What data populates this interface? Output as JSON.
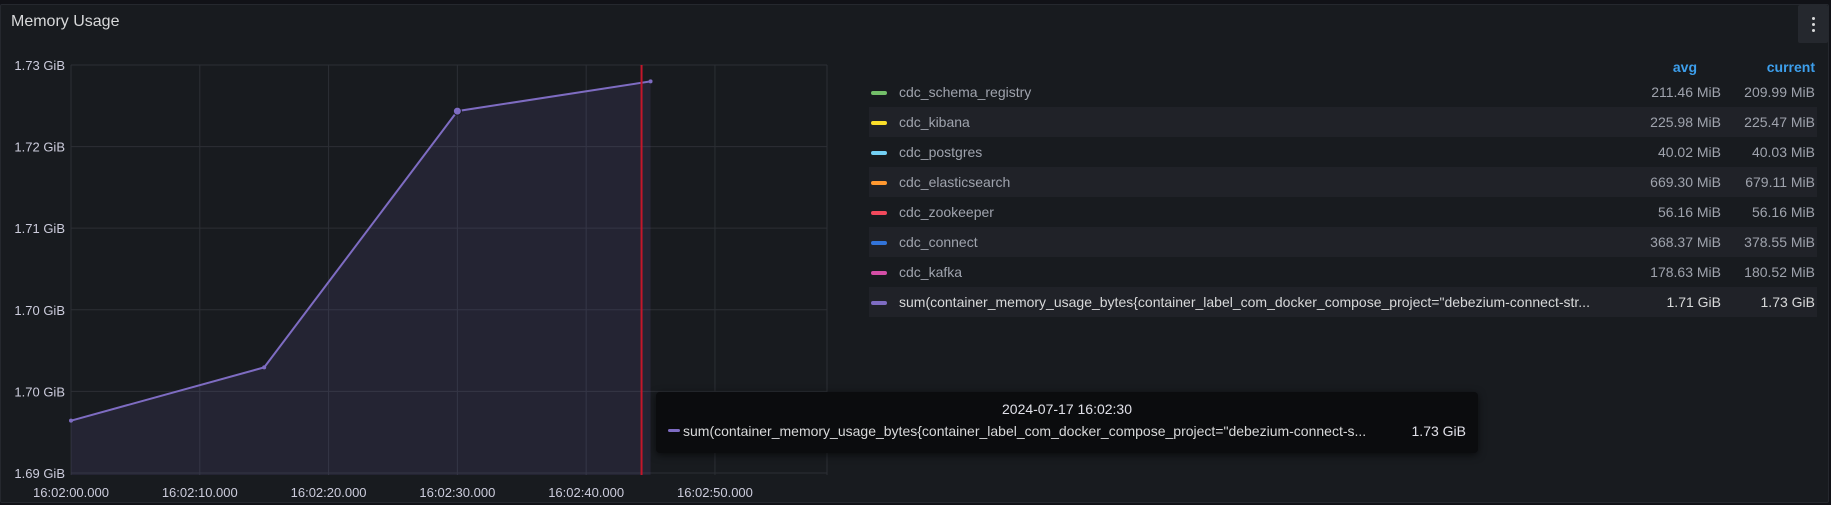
{
  "panel": {
    "title": "Memory Usage"
  },
  "chart_data": {
    "type": "area",
    "title": "Memory Usage",
    "y_ticks": [
      "1.73 GiB",
      "1.72 GiB",
      "1.71 GiB",
      "1.70 GiB",
      "1.70 GiB",
      "1.69 GiB"
    ],
    "x_ticks": [
      "16:02:00.000",
      "16:02:10.000",
      "16:02:20.000",
      "16:02:30.000",
      "16:02:40.000",
      "16:02:50.000"
    ],
    "x_range_seconds": [
      0,
      58.7
    ],
    "ylim_gib": [
      1.69,
      1.73
    ],
    "cursor_time": "16:02:44.3",
    "series": [
      {
        "name": "sum(container_memory_usage_bytes{container_label_com_docker_compose_project=\"debezium-connect-str...",
        "color": "#7e6cc2",
        "points": [
          {
            "t": "16:02:00",
            "gib": 1.6953
          },
          {
            "t": "16:02:15",
            "gib": 1.7005
          },
          {
            "t": "16:02:30",
            "gib": 1.7255
          },
          {
            "t": "16:02:45",
            "gib": 1.7284
          }
        ]
      }
    ],
    "grid": true
  },
  "legend": {
    "headers": {
      "avg": "avg",
      "current": "current"
    },
    "rows": [
      {
        "name": "cdc_schema_registry",
        "avg": "211.46 MiB",
        "current": "209.99 MiB",
        "color": "#73bf69"
      },
      {
        "name": "cdc_kibana",
        "avg": "225.98 MiB",
        "current": "225.47 MiB",
        "color": "#fade2a"
      },
      {
        "name": "cdc_postgres",
        "avg": "40.02 MiB",
        "current": "40.03 MiB",
        "color": "#5794f2"
      },
      {
        "name": "cdc_elasticsearch",
        "avg": "669.30 MiB",
        "current": "679.11 MiB",
        "color": "#ff9830"
      },
      {
        "name": "cdc_zookeeper",
        "avg": "56.16 MiB",
        "current": "56.16 MiB",
        "color": "#f2495c"
      },
      {
        "name": "cdc_connect",
        "avg": "368.37 MiB",
        "current": "378.55 MiB",
        "color": "#3274d9"
      },
      {
        "name": "cdc_kafka",
        "avg": "178.63 MiB",
        "current": "180.52 MiB",
        "color": "#d44ea6"
      },
      {
        "name": "sum(container_memory_usage_bytes{container_label_com_docker_compose_project=\"debezium-connect-str...",
        "avg": "1.71 GiB",
        "current": "1.73 GiB",
        "color": "#7e6cc2"
      }
    ]
  },
  "tooltip": {
    "time": "2024-07-17 16:02:30",
    "name": "sum(container_memory_usage_bytes{container_label_com_docker_compose_project=\"debezium-connect-s...",
    "value": "1.73 GiB",
    "color": "#7e6cc2"
  },
  "colors": {
    "postgres_swatch": "#73d0f4",
    "cursor_line": "#c4162a"
  }
}
